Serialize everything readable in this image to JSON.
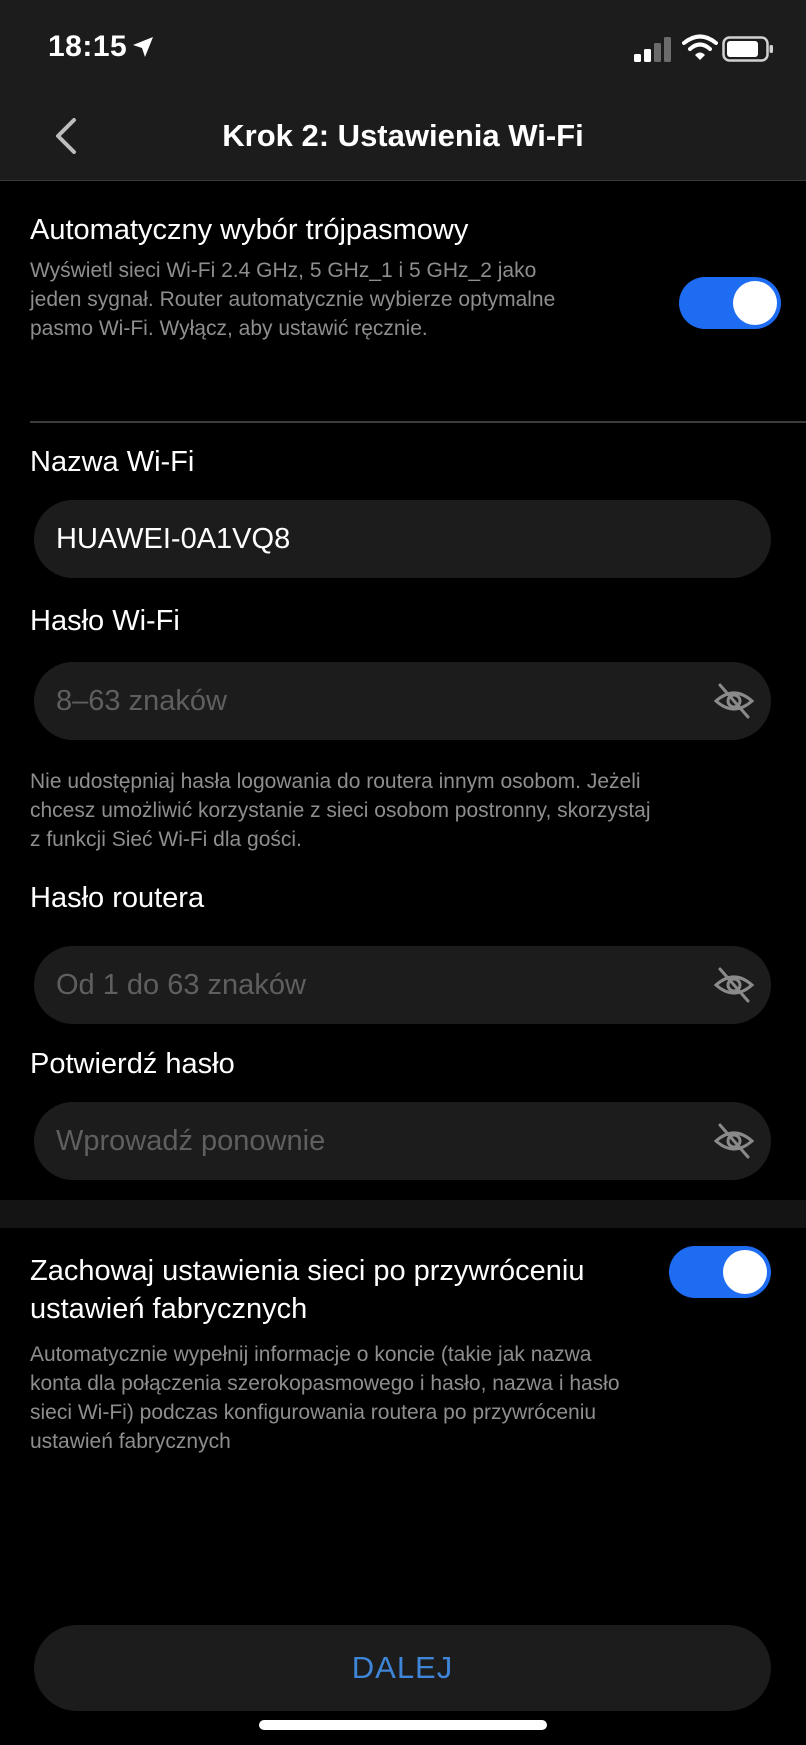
{
  "status_bar": {
    "time": "18:15"
  },
  "header": {
    "title": "Krok 2: Ustawienia Wi-Fi"
  },
  "triband": {
    "title": "Automatyczny wybór trójpasmowy",
    "description_lines": [
      "Wyświetl sieci Wi-Fi 2.4 GHz, 5 GHz_1 i 5 GHz_2 jako",
      "jeden sygnał. Router automatycznie wybierze optymalne",
      "pasmo Wi-Fi. Wyłącz, aby ustawić ręcznie."
    ],
    "enabled": true
  },
  "wifi_name": {
    "label": "Nazwa Wi-Fi",
    "value": "HUAWEI-0A1VQ8"
  },
  "wifi_password": {
    "label": "Hasło Wi-Fi",
    "placeholder": "8–63 znaków",
    "hint_lines": [
      "Nie udostępniaj hasła logowania do routera innym osobom. Jeżeli",
      "chcesz umożliwić korzystanie z sieci osobom postronny, skorzystaj",
      "z funkcji Sieć Wi-Fi dla gości."
    ]
  },
  "router_password": {
    "label": "Hasło routera",
    "placeholder": "Od 1 do 63 znaków"
  },
  "confirm_password": {
    "label": "Potwierdź hasło",
    "placeholder": "Wprowadź ponownie"
  },
  "keep_settings": {
    "title_lines": [
      "Zachowaj ustawienia sieci po przywróceniu",
      "ustawień fabrycznych"
    ],
    "description_lines": [
      "Automatycznie wypełnij informacje o koncie (takie jak nazwa",
      "konta dla połączenia szerokopasmowego i hasło, nazwa i hasło",
      "sieci Wi-Fi) podczas konfigurowania routera po przywróceniu",
      "ustawień fabrycznych"
    ],
    "enabled": true
  },
  "footer": {
    "next_label": "DALEJ"
  },
  "colors": {
    "accent": "#1d6cf2",
    "button_text": "#3f85d8",
    "background": "#000000",
    "surface": "#1c1c1c"
  },
  "icons": {
    "back": "chevron-left-icon",
    "eye": "eye-off-icon",
    "location": "location-arrow-icon",
    "signal": "cellular-signal-icon",
    "wifi": "wifi-icon",
    "battery": "battery-icon"
  }
}
